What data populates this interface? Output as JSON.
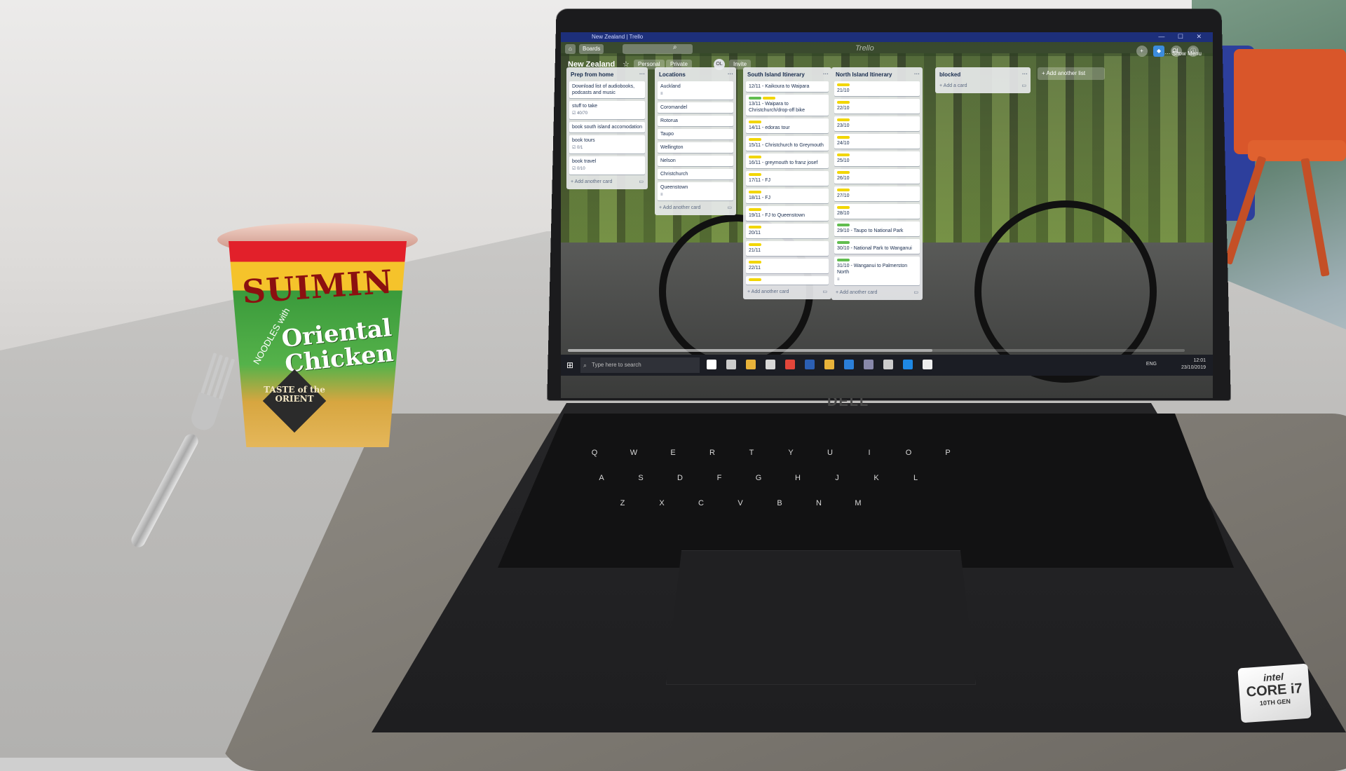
{
  "cup": {
    "brand": "SUIMIN",
    "noodles_with": "NOODLES with",
    "flavour": "Oriental Chicken",
    "badge": "TASTE of the ORIENT"
  },
  "laptop": {
    "brand": "DELL",
    "sticker": {
      "logo": "intel",
      "core": "CORE i7",
      "gen": "10TH GEN"
    },
    "keys_row1": [
      "Q",
      "W",
      "E",
      "R",
      "T",
      "Y",
      "U",
      "I",
      "O",
      "P"
    ],
    "keys_row2": [
      "A",
      "S",
      "D",
      "F",
      "G",
      "H",
      "J",
      "K",
      "L"
    ],
    "keys_row3": [
      "Z",
      "X",
      "C",
      "V",
      "B",
      "N",
      "M"
    ]
  },
  "screen": {
    "window_title": "New Zealand | Trello",
    "window_controls": "— ☐ ✕",
    "appbar": {
      "boards_label": "Boards",
      "logo": "Trello",
      "avatar": "OL"
    },
    "board": {
      "title": "New Zealand",
      "team_chip": "Personal",
      "visibility_chip": "Private",
      "member_avatar": "OL",
      "invite_label": "Invite",
      "show_menu": "··· Show Menu",
      "add_another_list": "+ Add another list"
    },
    "lists": [
      {
        "title": "Prep from home",
        "cards": [
          {
            "text": "Download list of audiobooks, podcasts and music"
          },
          {
            "text": "stuff to take",
            "badge": "☑ 40/70"
          },
          {
            "text": "book south island accomodation"
          },
          {
            "text": "book tours",
            "badge": "☑ 0/1"
          },
          {
            "text": "book travel",
            "badge": "☑ 0/10"
          }
        ],
        "add_label": "+ Add another card"
      },
      {
        "title": "Locations",
        "cards": [
          {
            "text": "Auckland",
            "badge": "≡"
          },
          {
            "text": "Coromandel"
          },
          {
            "text": "Rotorua"
          },
          {
            "text": "Taupo"
          },
          {
            "text": "Wellington"
          },
          {
            "text": "Nelson"
          },
          {
            "text": "Christchurch"
          },
          {
            "text": "Queenstown",
            "badge": "≡"
          }
        ],
        "add_label": "+ Add another card"
      },
      {
        "title": "South Island Itinerary",
        "cards": [
          {
            "text": "12/11 - Kaikoura to Waipara"
          },
          {
            "text": "13/11 - Waipara to Christchurch/drop-off bike",
            "labels": [
              "#61bd4f",
              "#f2d600"
            ]
          },
          {
            "text": "14/11 - edoras tour",
            "labels": [
              "#f2d600"
            ]
          },
          {
            "text": "15/11 - Christchurch to Greymouth",
            "labels": [
              "#f2d600"
            ]
          },
          {
            "text": "16/11 - greymouth to franz josef",
            "labels": [
              "#f2d600"
            ]
          },
          {
            "text": "17/11 - FJ",
            "labels": [
              "#f2d600"
            ]
          },
          {
            "text": "18/11 - FJ",
            "labels": [
              "#f2d600"
            ]
          },
          {
            "text": "19/11 - FJ to Queenstown",
            "labels": [
              "#f2d600"
            ]
          },
          {
            "text": "20/11",
            "labels": [
              "#f2d600"
            ]
          },
          {
            "text": "21/11",
            "labels": [
              "#f2d600"
            ]
          },
          {
            "text": "22/11",
            "labels": [
              "#f2d600"
            ]
          },
          {
            "text": "",
            "labels": [
              "#f2d600"
            ]
          }
        ],
        "add_label": "+ Add another card"
      },
      {
        "title": "North Island Itinerary",
        "cards": [
          {
            "text": "21/10",
            "labels": [
              "#f2d600"
            ]
          },
          {
            "text": "22/10",
            "labels": [
              "#f2d600"
            ]
          },
          {
            "text": "23/10",
            "labels": [
              "#f2d600"
            ]
          },
          {
            "text": "24/10",
            "labels": [
              "#f2d600"
            ]
          },
          {
            "text": "25/10",
            "labels": [
              "#f2d600"
            ]
          },
          {
            "text": "26/10",
            "labels": [
              "#f2d600"
            ]
          },
          {
            "text": "27/10",
            "labels": [
              "#f2d600"
            ]
          },
          {
            "text": "28/10",
            "labels": [
              "#f2d600"
            ]
          },
          {
            "text": "29/10 - Taupo to National Park",
            "labels": [
              "#61bd4f"
            ]
          },
          {
            "text": "30/10 - National Park to Wanganui",
            "labels": [
              "#61bd4f"
            ]
          },
          {
            "text": "31/10 - Wanganui to Palmerston North",
            "labels": [
              "#61bd4f"
            ],
            "badge": "≡"
          }
        ],
        "add_label": "+ Add another card"
      },
      {
        "title": "blocked",
        "cards": [],
        "add_label": "+ Add a card"
      }
    ],
    "taskbar": {
      "search_placeholder": "Type here to search",
      "app_colors": [
        "#ffffff",
        "#cccccc",
        "#e8b33a",
        "#d8d8d8",
        "#e3463a",
        "#2b5fb4",
        "#e8b33a",
        "#2b7fd9",
        "#8888aa",
        "#cccccc",
        "#1e88e5",
        "#eeeeee"
      ],
      "language": "ENG",
      "time": "12:01",
      "date": "23/10/2019"
    }
  }
}
